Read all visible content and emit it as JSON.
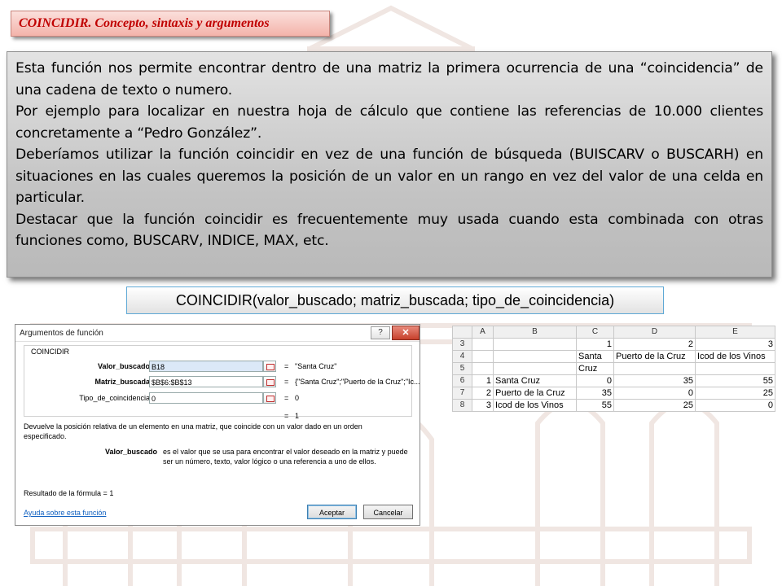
{
  "slide": {
    "title": "COINCIDIR. Concepto, sintaxis y argumentos",
    "paragraphs": [
      "Esta función nos permite encontrar dentro de una matriz la primera ocurrencia de una “coincidencia” de una cadena de texto o numero.",
      "Por ejemplo para localizar en nuestra hoja de cálculo que contiene las referencias de 10.000 clientes concretamente a “Pedro González”.",
      "Deberíamos utilizar la función coincidir en vez de una función de búsqueda (BUISCARV o BUSCARH) en situaciones en las cuales queremos la posición de un valor en un rango en vez del valor de una celda en particular.",
      "Destacar que la función coincidir  es frecuentemente muy usada cuando esta combinada con otras funciones como, BUSCARV, INDICE, MAX, etc."
    ],
    "syntax": {
      "function": "COINCIDIR",
      "args": "(valor_buscado; matriz_buscada; tipo_de_coincidencia)"
    }
  },
  "dialog": {
    "title": "Argumentos de función",
    "help_label": "?",
    "close_label": "✕",
    "group_label": "COINCIDIR",
    "arguments": [
      {
        "label": "Valor_buscado",
        "input": "B18",
        "result": "\"Santa Cruz\""
      },
      {
        "label": "Matriz_buscada",
        "input": "$B$6:$B$13",
        "result": "{\"Santa Cruz\";\"Puerto de la Cruz\";\"Ic..."
      },
      {
        "label": "Tipo_de_coincidencia",
        "input": "0",
        "result": "0"
      }
    ],
    "eq_sign": "=",
    "total_result": "1",
    "description": "Devuelve la posición relativa de un elemento en una matriz, que coincide con un valor dado en un orden especificado.",
    "arg_help_name": "Valor_buscado",
    "arg_help_text": "es el valor que se usa para encontrar el valor deseado en la matriz y puede ser un número, texto, valor lógico o una referencia a uno de ellos.",
    "formula_result_label": "Resultado de la fórmula =",
    "formula_result_value": "1",
    "help_link": "Ayuda sobre esta función",
    "accept_button": "Aceptar",
    "cancel_button": "Cancelar"
  },
  "sheet": {
    "columns": [
      "",
      "A",
      "B",
      "C",
      "D",
      "E"
    ],
    "rows": [
      {
        "row": "3",
        "cells": [
          "",
          "",
          "1",
          "2",
          "3"
        ]
      },
      {
        "row": "4",
        "cells": [
          "",
          "",
          "Santa",
          "Puerto de la Cruz",
          "Icod de los Vinos"
        ]
      },
      {
        "row": "5",
        "cells": [
          "",
          "",
          "Cruz",
          "",
          ""
        ]
      },
      {
        "row": "6",
        "cells": [
          "1",
          "Santa Cruz",
          "0",
          "35",
          "55"
        ]
      },
      {
        "row": "7",
        "cells": [
          "2",
          "Puerto de la Cruz",
          "35",
          "0",
          "25"
        ]
      },
      {
        "row": "8",
        "cells": [
          "3",
          "Icod de los Vinos",
          "55",
          "25",
          "0"
        ]
      }
    ]
  }
}
